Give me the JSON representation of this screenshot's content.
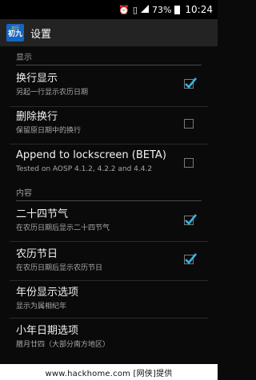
{
  "status_bar": {
    "battery_percent": "73%",
    "time": "10:24",
    "icons": [
      "alarm-clock-icon",
      "vibrate-icon",
      "signal-icon",
      "battery-icon"
    ]
  },
  "action_bar": {
    "app_icon_top": "农历",
    "app_icon_bottom": "初九",
    "title": "设置"
  },
  "sections": [
    {
      "header": "显示"
    },
    {
      "header": "内容"
    }
  ],
  "settings": [
    {
      "title": "换行显示",
      "subtitle": "另起一行显示农历日期",
      "checked": true
    },
    {
      "title": "删除换行",
      "subtitle": "保留原日期中的换行",
      "checked": false
    },
    {
      "title": "Append to lockscreen (BETA)",
      "subtitle": "Tested on AOSP 4.1.2, 4.2.2 and 4.4.2",
      "checked": false
    },
    {
      "title": "二十四节气",
      "subtitle": "在农历日期后显示二十四节气",
      "checked": true
    },
    {
      "title": "农历节日",
      "subtitle": "在农历日期后显示农历节日",
      "checked": true
    },
    {
      "title": "年份显示选项",
      "subtitle": "显示为属相纪年"
    },
    {
      "title": "小年日期选项",
      "subtitle": "腊月廿四（大部分南方地区）"
    }
  ],
  "accent_color": "#33b5e5",
  "watermark": "www.hackhome.com [网侠]提供"
}
